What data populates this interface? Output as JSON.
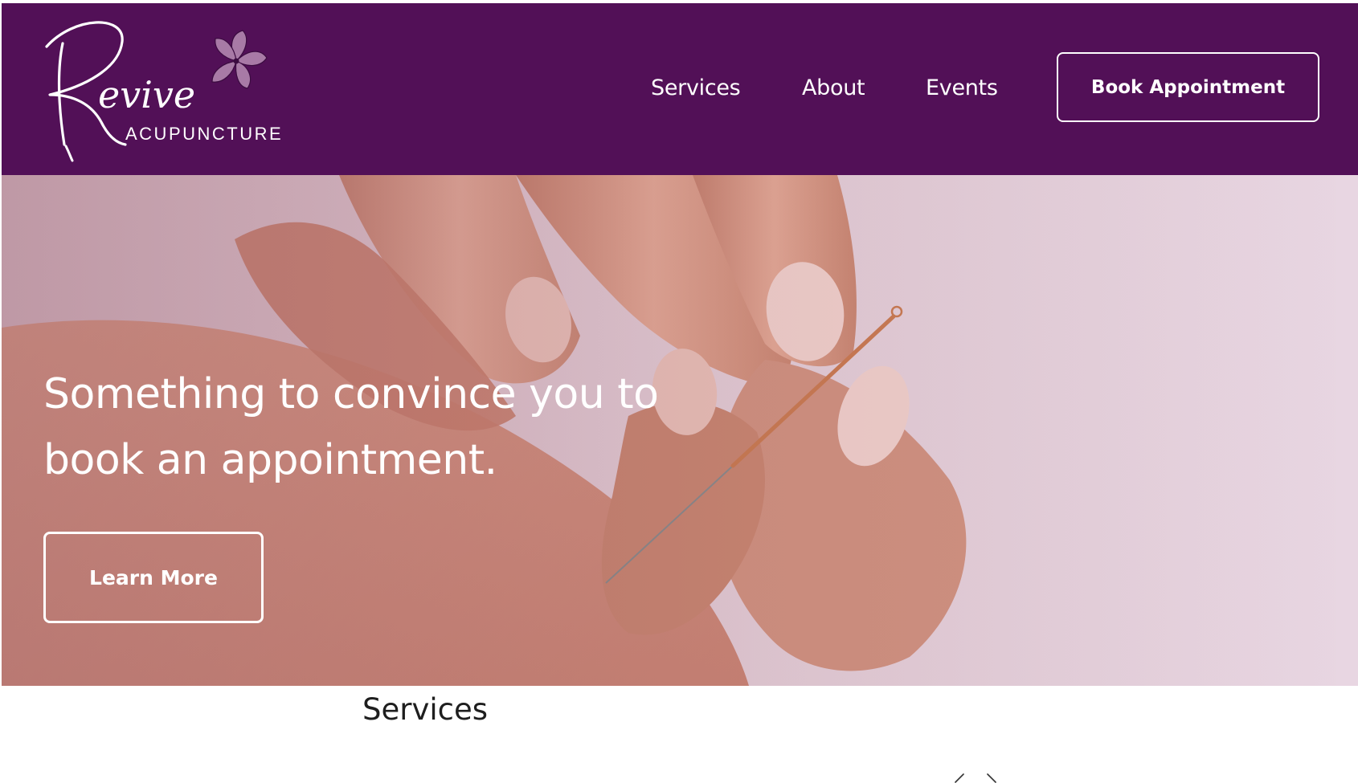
{
  "brand": {
    "name": "Revive",
    "subtitle": "ACUPUNCTURE",
    "colors": {
      "header_bg": "#521057",
      "flower": "#a87aa6",
      "text_light": "#ffffff"
    }
  },
  "nav": {
    "items": [
      {
        "label": "Services"
      },
      {
        "label": "About"
      },
      {
        "label": "Events"
      }
    ],
    "cta_label": "Book Appointment"
  },
  "hero": {
    "heading": "Something to convince you to book an appointment.",
    "button_label": "Learn More",
    "image": "hand holding acupuncture needle over shoulder"
  },
  "services": {
    "title": "Services",
    "carousel_icons": [
      "chevron-left-icon",
      "chevron-right-icon"
    ]
  }
}
